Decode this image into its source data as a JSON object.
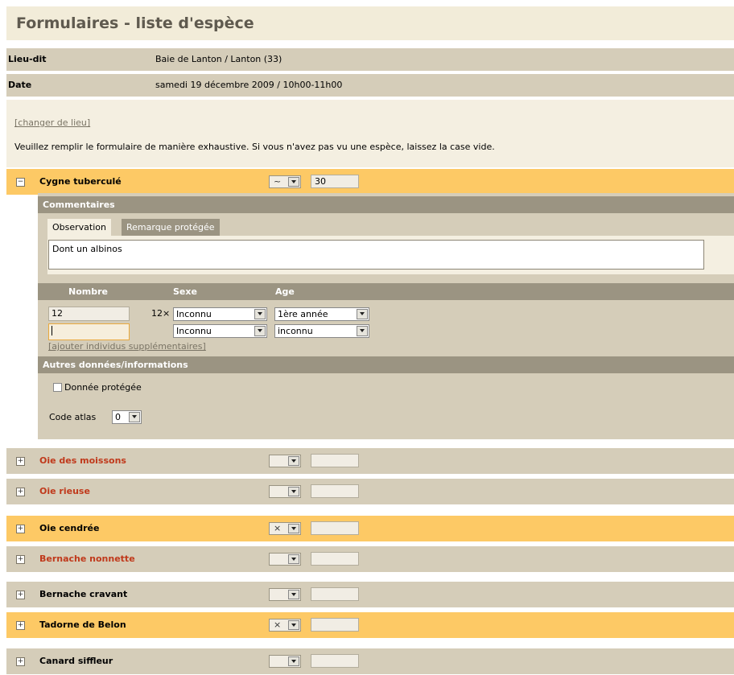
{
  "page_title": "Formulaires - liste d'espèce",
  "info": [
    {
      "label": "Lieu-dit",
      "value": "Baie de Lanton / Lanton (33)"
    },
    {
      "label": "Date",
      "value": "samedi 19 décembre 2009 / 10h00-11h00"
    }
  ],
  "change_location_link": "[changer de lieu]",
  "instructions": "Veuillez remplir le formulaire de manière exhaustive. Si vous n'avez pas vu une espèce, laissez la case vide.",
  "expanded_species": {
    "toggle": "−",
    "name": "Cygne tuberculé",
    "precision": "~",
    "count": "30",
    "comments_header": "Commentaires",
    "tabs": [
      "Observation",
      "Remarque protégée"
    ],
    "observation_text": "Dont un albinos",
    "columns": [
      "Nombre",
      "Sexe",
      "Age"
    ],
    "individuals": [
      {
        "number": "12",
        "multiplier": "12×",
        "sex": "Inconnu",
        "age": "1ère année"
      },
      {
        "number": "",
        "multiplier": "",
        "sex": "Inconnu",
        "age": "inconnu"
      }
    ],
    "add_individuals_link": "[ajouter individus supplémentaires]",
    "other_data_header": "Autres données/informations",
    "protected_label": "Donnée protégée",
    "atlas_label": "Code atlas",
    "atlas_value": "0"
  },
  "species": [
    {
      "name": "Oie des moissons",
      "precision": "",
      "count": "",
      "highlight": false,
      "red": true
    },
    {
      "name": "Oie rieuse",
      "precision": "",
      "count": "",
      "highlight": false,
      "red": true
    },
    {
      "name": "Oie cendrée",
      "precision": "×",
      "count": "",
      "highlight": true,
      "red": false
    },
    {
      "name": "Bernache nonnette",
      "precision": "",
      "count": "",
      "highlight": false,
      "red": true
    },
    {
      "name": "Bernache cravant",
      "precision": "",
      "count": "",
      "highlight": false,
      "red": false
    },
    {
      "name": "Tadorne de Belon",
      "precision": "×",
      "count": "",
      "highlight": true,
      "red": false
    },
    {
      "name": "Canard siffleur",
      "precision": "",
      "count": "",
      "highlight": false,
      "red": false
    }
  ],
  "collapsed_toggle": "+",
  "colors": {
    "orange_row": "#fdc965",
    "beige_row": "#d5cdb9",
    "header_gray": "#9b9482",
    "red_name": "#c0391b"
  }
}
